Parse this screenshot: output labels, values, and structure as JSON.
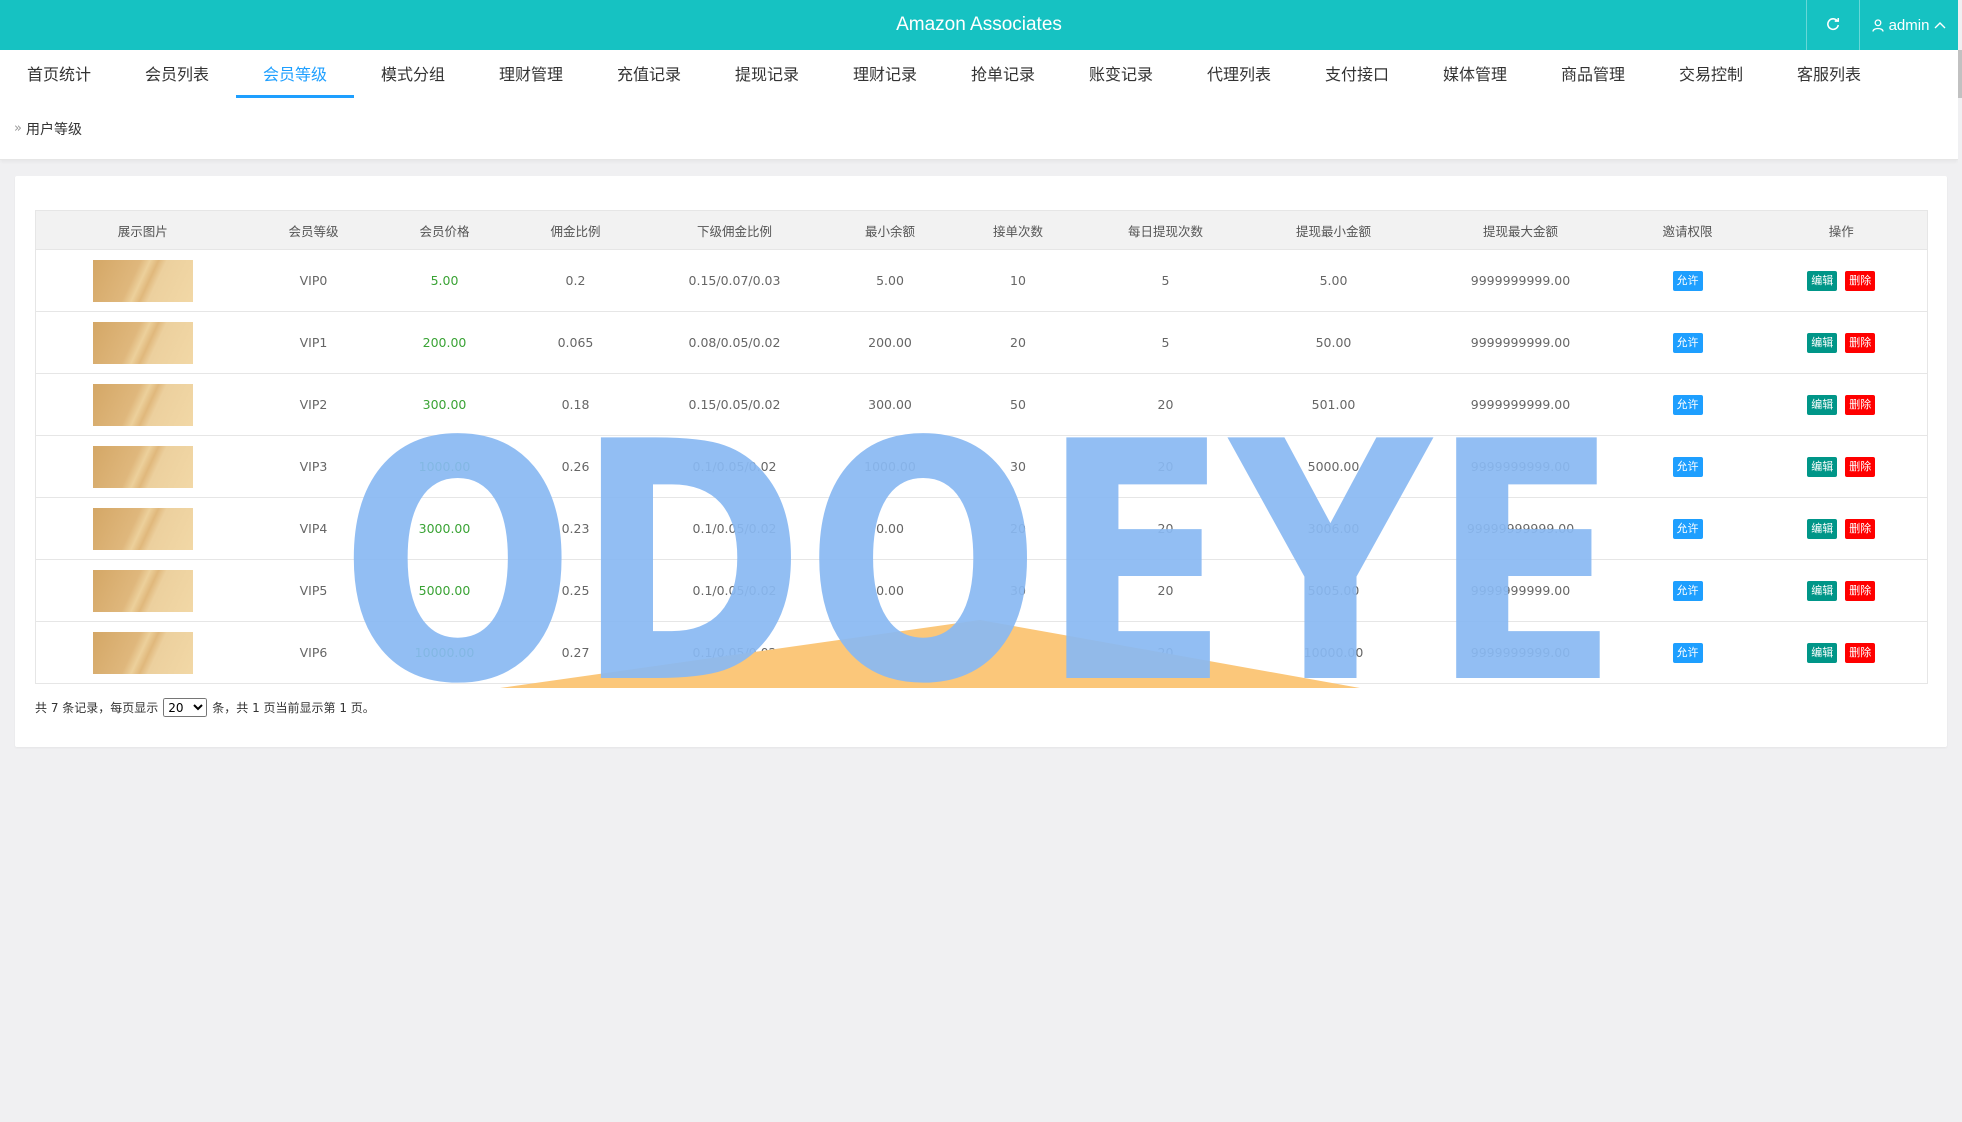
{
  "header": {
    "title": "Amazon Associates",
    "user": "admin",
    "colors": {
      "bar": "#16c2c2",
      "accent": "#1e9fff"
    }
  },
  "nav": {
    "tabs": [
      {
        "label": "首页统计"
      },
      {
        "label": "会员列表"
      },
      {
        "label": "会员等级",
        "active": true
      },
      {
        "label": "模式分组"
      },
      {
        "label": "理财管理"
      },
      {
        "label": "充值记录"
      },
      {
        "label": "提现记录"
      },
      {
        "label": "理财记录"
      },
      {
        "label": "抢单记录"
      },
      {
        "label": "账变记录"
      },
      {
        "label": "代理列表"
      },
      {
        "label": "支付接口"
      },
      {
        "label": "媒体管理"
      },
      {
        "label": "商品管理"
      },
      {
        "label": "交易控制"
      },
      {
        "label": "客服列表"
      }
    ]
  },
  "breadcrumb": {
    "current": "用户等级"
  },
  "table": {
    "columns": [
      "展示图片",
      "会员等级",
      "会员价格",
      "佣金比例",
      "下级佣金比例",
      "最小余额",
      "接单次数",
      "每日提现次数",
      "提现最小金额",
      "提现最大金额",
      "邀请权限",
      "操作"
    ],
    "rows": [
      {
        "level": "VIP0",
        "price": "5.00",
        "commission": "0.2",
        "sub_commission": "0.15/0.07/0.03",
        "min_balance": "5.00",
        "orders": "10",
        "daily_withdraw": "5",
        "withdraw_min": "5.00",
        "withdraw_max": "9999999999.00",
        "invite": "允许"
      },
      {
        "level": "VIP1",
        "price": "200.00",
        "commission": "0.065",
        "sub_commission": "0.08/0.05/0.02",
        "min_balance": "200.00",
        "orders": "20",
        "daily_withdraw": "5",
        "withdraw_min": "50.00",
        "withdraw_max": "9999999999.00",
        "invite": "允许"
      },
      {
        "level": "VIP2",
        "price": "300.00",
        "commission": "0.18",
        "sub_commission": "0.15/0.05/0.02",
        "min_balance": "300.00",
        "orders": "50",
        "daily_withdraw": "20",
        "withdraw_min": "501.00",
        "withdraw_max": "9999999999.00",
        "invite": "允许"
      },
      {
        "level": "VIP3",
        "price": "1000.00",
        "commission": "0.26",
        "sub_commission": "0.1/0.05/0.02",
        "min_balance": "1000.00",
        "orders": "30",
        "daily_withdraw": "20",
        "withdraw_min": "5000.00",
        "withdraw_max": "9999999999.00",
        "invite": "允许"
      },
      {
        "level": "VIP4",
        "price": "3000.00",
        "commission": "0.23",
        "sub_commission": "0.1/0.05/0.02",
        "min_balance": "0.00",
        "orders": "20",
        "daily_withdraw": "20",
        "withdraw_min": "3006.00",
        "withdraw_max": "99999999999.00",
        "invite": "允许"
      },
      {
        "level": "VIP5",
        "price": "5000.00",
        "commission": "0.25",
        "sub_commission": "0.1/0.05/0.02",
        "min_balance": "0.00",
        "orders": "30",
        "daily_withdraw": "20",
        "withdraw_min": "5005.00",
        "withdraw_max": "9999999999.00",
        "invite": "允许"
      },
      {
        "level": "VIP6",
        "price": "10000.00",
        "commission": "0.27",
        "sub_commission": "0.1/0.05/0.02",
        "min_balance": "0.00",
        "orders": "60",
        "daily_withdraw": "20",
        "withdraw_min": "10000.00",
        "withdraw_max": "9999999999.00",
        "invite": "允许"
      }
    ],
    "actions": {
      "edit": "编辑",
      "delete": "删除"
    },
    "colors": {
      "price": "#3aa335",
      "allow": "#1e9fff",
      "edit": "#009688",
      "delete": "#ff0000"
    }
  },
  "pager": {
    "prefix": "共 7 条记录，每页显示",
    "page_size": "20",
    "suffix": "条，共 1 页当前显示第 1 页。"
  },
  "watermark": {
    "text": "ODOEYE",
    "color": "#89b8f2"
  }
}
